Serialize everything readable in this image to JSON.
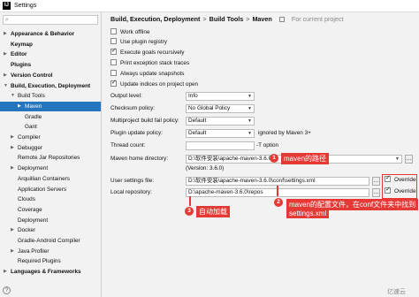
{
  "window": {
    "title": "Settings",
    "icon_letter": "IJ"
  },
  "sidebar": {
    "items": [
      {
        "label": "Appearance & Behavior",
        "bold": true,
        "arrow": ">"
      },
      {
        "label": "Keymap",
        "bold": true,
        "arrow": ""
      },
      {
        "label": "Editor",
        "bold": true,
        "arrow": ">"
      },
      {
        "label": "Plugins",
        "bold": true,
        "arrow": ""
      },
      {
        "label": "Version Control",
        "bold": true,
        "arrow": ">"
      },
      {
        "label": "Build, Execution, Deployment",
        "bold": true,
        "arrow": "v"
      },
      {
        "label": "Build Tools",
        "bold": false,
        "arrow": "v"
      },
      {
        "label": "Maven",
        "bold": false,
        "arrow": ">",
        "selected": true
      },
      {
        "label": "Gradle",
        "bold": false,
        "arrow": ""
      },
      {
        "label": "Gant",
        "bold": false,
        "arrow": ""
      },
      {
        "label": "Compiler",
        "bold": false,
        "arrow": ">"
      },
      {
        "label": "Debugger",
        "bold": false,
        "arrow": ">"
      },
      {
        "label": "Remote Jar Repositories",
        "bold": false,
        "arrow": ""
      },
      {
        "label": "Deployment",
        "bold": false,
        "arrow": ">"
      },
      {
        "label": "Arquillian Containers",
        "bold": false,
        "arrow": ""
      },
      {
        "label": "Application Servers",
        "bold": false,
        "arrow": ""
      },
      {
        "label": "Clouds",
        "bold": false,
        "arrow": ""
      },
      {
        "label": "Coverage",
        "bold": false,
        "arrow": ""
      },
      {
        "label": "Deployment",
        "bold": false,
        "arrow": ""
      },
      {
        "label": "Docker",
        "bold": false,
        "arrow": ">"
      },
      {
        "label": "Gradle-Android Compiler",
        "bold": false,
        "arrow": ""
      },
      {
        "label": "Java Profiler",
        "bold": false,
        "arrow": ">"
      },
      {
        "label": "Required Plugins",
        "bold": false,
        "arrow": ""
      },
      {
        "label": "Languages & Frameworks",
        "bold": true,
        "arrow": ">"
      }
    ]
  },
  "breadcrumb": {
    "items": [
      "Build, Execution, Deployment",
      "Build Tools",
      "Maven"
    ],
    "sep": ">",
    "project_note": "For current project"
  },
  "checkboxes": [
    {
      "label": "Work offline",
      "checked": false
    },
    {
      "label": "Use plugin registry",
      "checked": false
    },
    {
      "label": "Execute goals recursively",
      "checked": true
    },
    {
      "label": "Print exception stack traces",
      "checked": false
    },
    {
      "label": "Always update snapshots",
      "checked": false
    },
    {
      "label": "Update indices on project open",
      "checked": true
    }
  ],
  "fields": {
    "output_level": {
      "label": "Output level:",
      "value": "Info"
    },
    "checksum_policy": {
      "label": "Checksum policy:",
      "value": "No Global Policy"
    },
    "multiproject": {
      "label": "Multiproject build fail policy:",
      "value": "Default"
    },
    "plugin_update": {
      "label": "Plugin update policy:",
      "value": "Default",
      "note": "ignored by Maven 3+"
    },
    "thread_count": {
      "label": "Thread count:",
      "value": "",
      "note": "-T option"
    },
    "maven_home": {
      "label": "Maven home directory:",
      "value": "D:\\软件安装\\apache-maven-3.6.0",
      "version": "(Version: 3.6.0)"
    },
    "user_settings": {
      "label": "User settings file:",
      "value": "D:\\软件安装\\apache-maven-3.6.0\\conf\\settings.xml",
      "override": "Override"
    },
    "local_repo": {
      "label": "Local repository:",
      "value": "D:\\apache-maven-3.6.0\\repos",
      "override": "Override"
    }
  },
  "annotations": {
    "a1": {
      "num": "1",
      "text": "maven的路径"
    },
    "a2": {
      "num": "2",
      "text1": "maven的配置文件，在conf文件夹中找到",
      "text2": "settings.xml"
    },
    "a3": {
      "num": "3",
      "text": "自动加载"
    }
  },
  "watermark": "亿速云",
  "colors": {
    "accent": "#2675bf",
    "annotation": "#e53935"
  }
}
